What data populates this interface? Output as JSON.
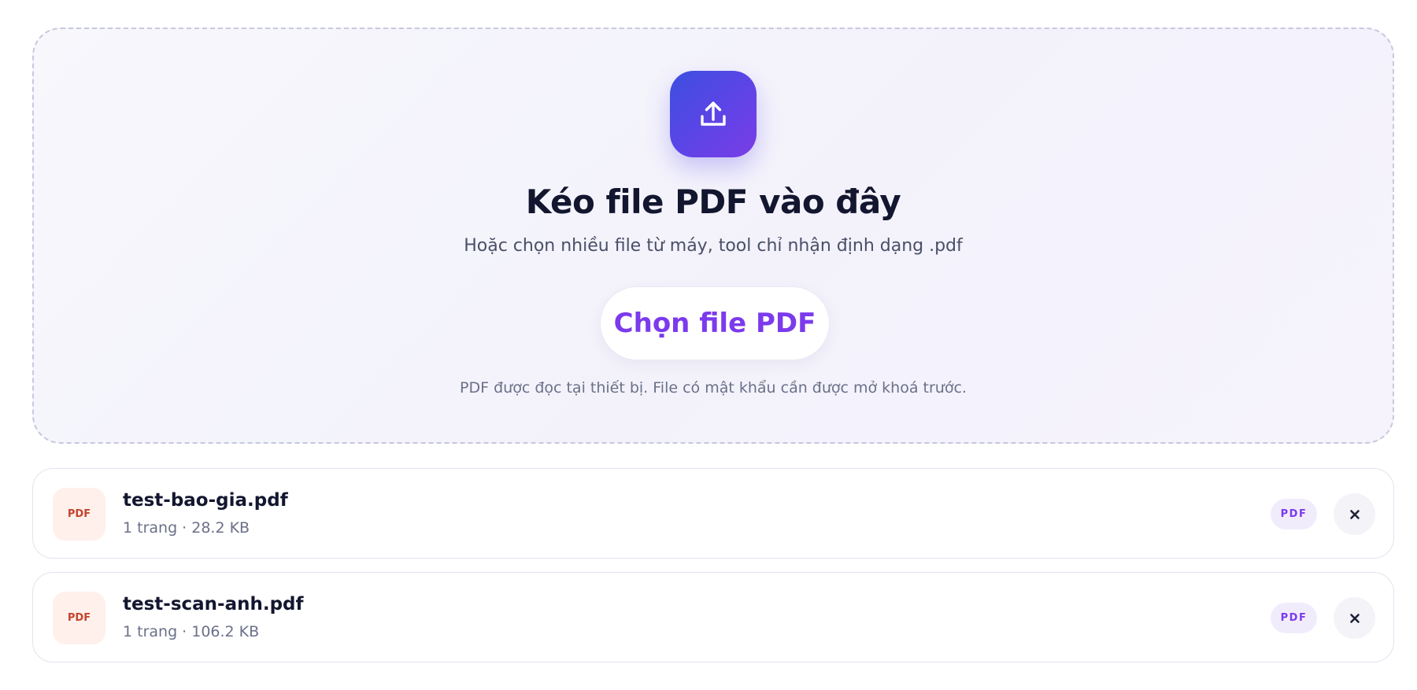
{
  "dropzone": {
    "icon": "upload-icon",
    "title": "Kéo file PDF vào đây",
    "subtitle": "Hoặc chọn nhiều file từ máy, tool chỉ nhận định dạng .pdf",
    "button_label": "Chọn file PDF",
    "note": "PDF được đọc tại thiết bị. File có mật khẩu cần được mở khoá trước.",
    "colors": {
      "accent": "#7c3aed",
      "badge_gradient_start": "#3d4fe0",
      "badge_gradient_end": "#7a3ce6"
    }
  },
  "files": [
    {
      "thumb_label": "PDF",
      "name": "test-bao-gia.pdf",
      "meta": "1 trang · 28.2 KB",
      "badge": "PDF",
      "remove_icon": "close-icon"
    },
    {
      "thumb_label": "PDF",
      "name": "test-scan-anh.pdf",
      "meta": "1 trang · 106.2 KB",
      "badge": "PDF",
      "remove_icon": "close-icon"
    }
  ]
}
